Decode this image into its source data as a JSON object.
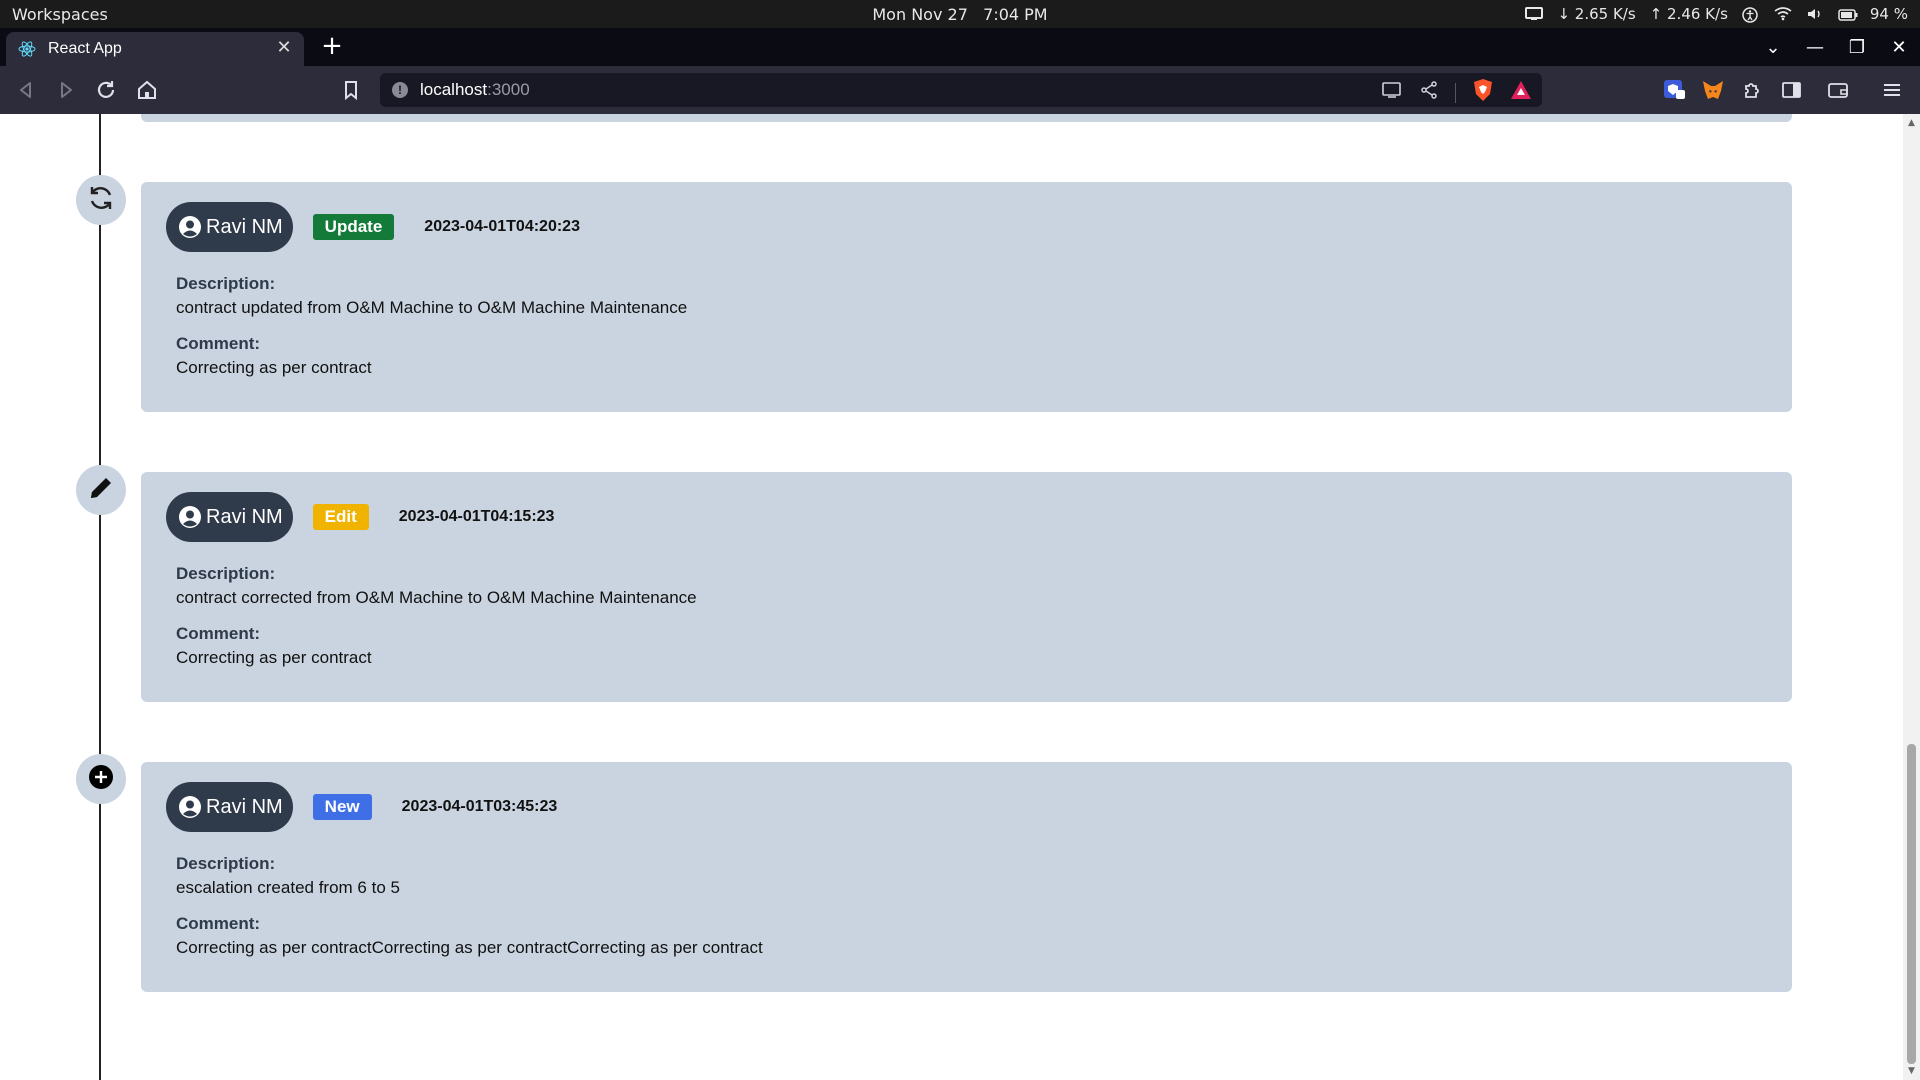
{
  "os": {
    "workspaces": "Workspaces",
    "date": "Mon Nov 27",
    "time": "7:04 PM",
    "net_down": "↓ 2.65 K/s",
    "net_up": "↑ 2.46 K/s",
    "battery": "94 %"
  },
  "browser": {
    "tab_title": "React App",
    "url_host": "localhost",
    "url_port": ":3000"
  },
  "timeline": [
    {
      "icon": "refresh-icon",
      "user": "Ravi NM",
      "type": "Update",
      "timestamp": "2023-04-01T04:20:23",
      "description_label": "Description:",
      "description": "contract updated from O&M Machine to O&M Machine Maintenance",
      "comment_label": "Comment:",
      "comment": "Correcting as per contract"
    },
    {
      "icon": "pencil-icon",
      "user": "Ravi NM",
      "type": "Edit",
      "timestamp": "2023-04-01T04:15:23",
      "description_label": "Description:",
      "description": "contract corrected from O&M Machine to O&M Machine Maintenance",
      "comment_label": "Comment:",
      "comment": "Correcting as per contract"
    },
    {
      "icon": "plus-circle-icon",
      "user": "Ravi NM",
      "type": "New",
      "timestamp": "2023-04-01T03:45:23",
      "description_label": "Description:",
      "description": "escalation created from 6 to 5",
      "comment_label": "Comment:",
      "comment": "Correcting as per contractCorrecting as per contractCorrecting as per contract"
    }
  ]
}
